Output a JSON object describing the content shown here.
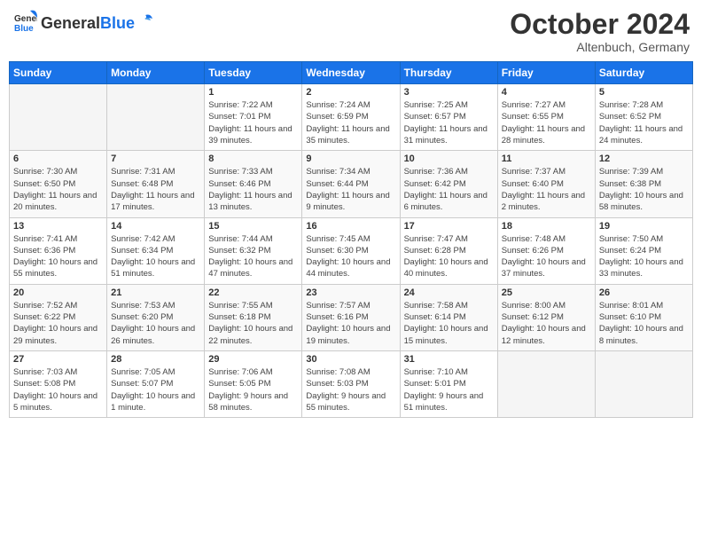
{
  "header": {
    "logo": {
      "general": "General",
      "blue": "Blue"
    },
    "month": "October 2024",
    "location": "Altenbuch, Germany"
  },
  "weekdays": [
    "Sunday",
    "Monday",
    "Tuesday",
    "Wednesday",
    "Thursday",
    "Friday",
    "Saturday"
  ],
  "weeks": [
    [
      null,
      null,
      {
        "day": 1,
        "sunrise": "7:22 AM",
        "sunset": "7:01 PM",
        "daylight": "11 hours and 39 minutes."
      },
      {
        "day": 2,
        "sunrise": "7:24 AM",
        "sunset": "6:59 PM",
        "daylight": "11 hours and 35 minutes."
      },
      {
        "day": 3,
        "sunrise": "7:25 AM",
        "sunset": "6:57 PM",
        "daylight": "11 hours and 31 minutes."
      },
      {
        "day": 4,
        "sunrise": "7:27 AM",
        "sunset": "6:55 PM",
        "daylight": "11 hours and 28 minutes."
      },
      {
        "day": 5,
        "sunrise": "7:28 AM",
        "sunset": "6:52 PM",
        "daylight": "11 hours and 24 minutes."
      }
    ],
    [
      {
        "day": 6,
        "sunrise": "7:30 AM",
        "sunset": "6:50 PM",
        "daylight": "11 hours and 20 minutes."
      },
      {
        "day": 7,
        "sunrise": "7:31 AM",
        "sunset": "6:48 PM",
        "daylight": "11 hours and 17 minutes."
      },
      {
        "day": 8,
        "sunrise": "7:33 AM",
        "sunset": "6:46 PM",
        "daylight": "11 hours and 13 minutes."
      },
      {
        "day": 9,
        "sunrise": "7:34 AM",
        "sunset": "6:44 PM",
        "daylight": "11 hours and 9 minutes."
      },
      {
        "day": 10,
        "sunrise": "7:36 AM",
        "sunset": "6:42 PM",
        "daylight": "11 hours and 6 minutes."
      },
      {
        "day": 11,
        "sunrise": "7:37 AM",
        "sunset": "6:40 PM",
        "daylight": "11 hours and 2 minutes."
      },
      {
        "day": 12,
        "sunrise": "7:39 AM",
        "sunset": "6:38 PM",
        "daylight": "10 hours and 58 minutes."
      }
    ],
    [
      {
        "day": 13,
        "sunrise": "7:41 AM",
        "sunset": "6:36 PM",
        "daylight": "10 hours and 55 minutes."
      },
      {
        "day": 14,
        "sunrise": "7:42 AM",
        "sunset": "6:34 PM",
        "daylight": "10 hours and 51 minutes."
      },
      {
        "day": 15,
        "sunrise": "7:44 AM",
        "sunset": "6:32 PM",
        "daylight": "10 hours and 47 minutes."
      },
      {
        "day": 16,
        "sunrise": "7:45 AM",
        "sunset": "6:30 PM",
        "daylight": "10 hours and 44 minutes."
      },
      {
        "day": 17,
        "sunrise": "7:47 AM",
        "sunset": "6:28 PM",
        "daylight": "10 hours and 40 minutes."
      },
      {
        "day": 18,
        "sunrise": "7:48 AM",
        "sunset": "6:26 PM",
        "daylight": "10 hours and 37 minutes."
      },
      {
        "day": 19,
        "sunrise": "7:50 AM",
        "sunset": "6:24 PM",
        "daylight": "10 hours and 33 minutes."
      }
    ],
    [
      {
        "day": 20,
        "sunrise": "7:52 AM",
        "sunset": "6:22 PM",
        "daylight": "10 hours and 29 minutes."
      },
      {
        "day": 21,
        "sunrise": "7:53 AM",
        "sunset": "6:20 PM",
        "daylight": "10 hours and 26 minutes."
      },
      {
        "day": 22,
        "sunrise": "7:55 AM",
        "sunset": "6:18 PM",
        "daylight": "10 hours and 22 minutes."
      },
      {
        "day": 23,
        "sunrise": "7:57 AM",
        "sunset": "6:16 PM",
        "daylight": "10 hours and 19 minutes."
      },
      {
        "day": 24,
        "sunrise": "7:58 AM",
        "sunset": "6:14 PM",
        "daylight": "10 hours and 15 minutes."
      },
      {
        "day": 25,
        "sunrise": "8:00 AM",
        "sunset": "6:12 PM",
        "daylight": "10 hours and 12 minutes."
      },
      {
        "day": 26,
        "sunrise": "8:01 AM",
        "sunset": "6:10 PM",
        "daylight": "10 hours and 8 minutes."
      }
    ],
    [
      {
        "day": 27,
        "sunrise": "7:03 AM",
        "sunset": "5:08 PM",
        "daylight": "10 hours and 5 minutes."
      },
      {
        "day": 28,
        "sunrise": "7:05 AM",
        "sunset": "5:07 PM",
        "daylight": "10 hours and 1 minute."
      },
      {
        "day": 29,
        "sunrise": "7:06 AM",
        "sunset": "5:05 PM",
        "daylight": "9 hours and 58 minutes."
      },
      {
        "day": 30,
        "sunrise": "7:08 AM",
        "sunset": "5:03 PM",
        "daylight": "9 hours and 55 minutes."
      },
      {
        "day": 31,
        "sunrise": "7:10 AM",
        "sunset": "5:01 PM",
        "daylight": "9 hours and 51 minutes."
      },
      null,
      null
    ]
  ]
}
